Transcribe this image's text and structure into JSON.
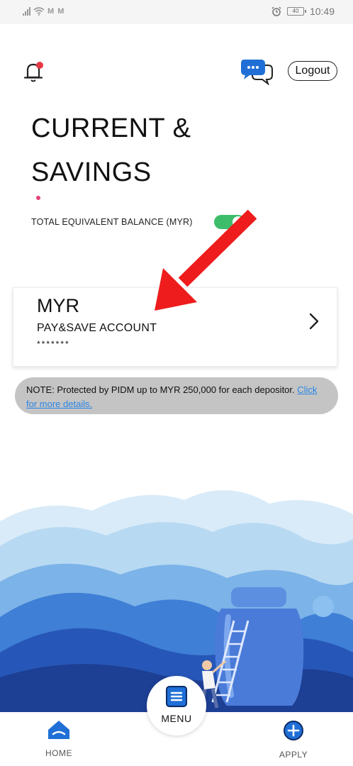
{
  "status_bar": {
    "time": "10:49",
    "battery_level": "40",
    "carrier_icons": "M M"
  },
  "header": {
    "logout_label": "Logout"
  },
  "page": {
    "title_line1": "CURRENT &",
    "title_line2": "SAVINGS"
  },
  "balance": {
    "label": "TOTAL EQUIVALENT BALANCE (MYR)",
    "toggle_on": true
  },
  "account": {
    "currency": "MYR",
    "name": "PAY&SAVE ACCOUNT",
    "masked_number": "*******"
  },
  "note": {
    "text": "NOTE: Protected by PIDM up to MYR 250,000 for each depositor.",
    "link_text": "Click for more details."
  },
  "nav": {
    "home_label": "HOME",
    "menu_label": "MENU",
    "apply_label": "APPLY"
  },
  "icons": {
    "bell": "bell-icon",
    "chat": "chat-icon",
    "chevron": "chevron-right-icon",
    "home": "home-icon",
    "menu": "menu-icon",
    "apply": "plus-circle-icon"
  },
  "colors": {
    "primary_blue": "#1f6fd6",
    "toggle_green": "#3dbd6a",
    "notification_red": "#e53945",
    "link_blue": "#2a86e6",
    "annotation_red": "#ee1c1c"
  }
}
